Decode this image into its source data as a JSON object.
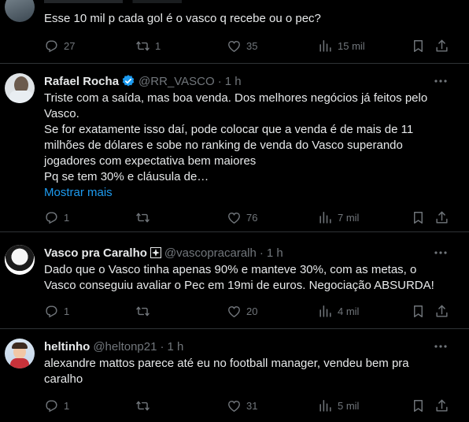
{
  "tweet0": {
    "text_lines": [
      "Esse 10 mil p cada gol é o vasco q recebe ou o pec?"
    ],
    "replies": "27",
    "retweets": "1",
    "likes": "35",
    "views": "15 mil"
  },
  "tweet1": {
    "name": "Rafael Rocha",
    "handle": "@RR_VASCO",
    "separator": "·",
    "time": "1 h",
    "text_lines": [
      "Triste com a saída, mas boa venda. Dos melhores negócios já feitos pelo",
      "Vasco.",
      "Se for exatamente isso daí, pode colocar que a venda é de mais de 11",
      "milhões de dólares e sobe no ranking de venda do Vasco superando",
      "jogadores com expectativa bem maiores",
      "Pq se tem 30% e cláusula de…"
    ],
    "show_more": "Mostrar mais",
    "replies": "1",
    "retweets": "",
    "likes": "76",
    "views": "7 mil"
  },
  "tweet2": {
    "name": "Vasco pra Caralho",
    "handle": "@vascopracaralh",
    "separator": "·",
    "time": "1 h",
    "text_lines": [
      "Dado que o Vasco tinha apenas 90% e manteve 30%, com as metas, o",
      "Vasco conseguiu avaliar o Pec em 19mi de euros. Negociação ABSURDA!"
    ],
    "replies": "1",
    "retweets": "",
    "likes": "20",
    "views": "4 mil"
  },
  "tweet3": {
    "name": "heltinho",
    "handle": "@heltonp21",
    "separator": "·",
    "time": "1 h",
    "text_lines": [
      "alexandre mattos parece até eu no football manager, vendeu bem pra",
      "caralho"
    ],
    "replies": "1",
    "retweets": "",
    "likes": "31",
    "views": "5 mil"
  },
  "colors": {
    "background": "#000000",
    "text": "#e7e9ea",
    "muted": "#71767b",
    "link": "#1d9bf0",
    "divider": "#2f3336"
  }
}
